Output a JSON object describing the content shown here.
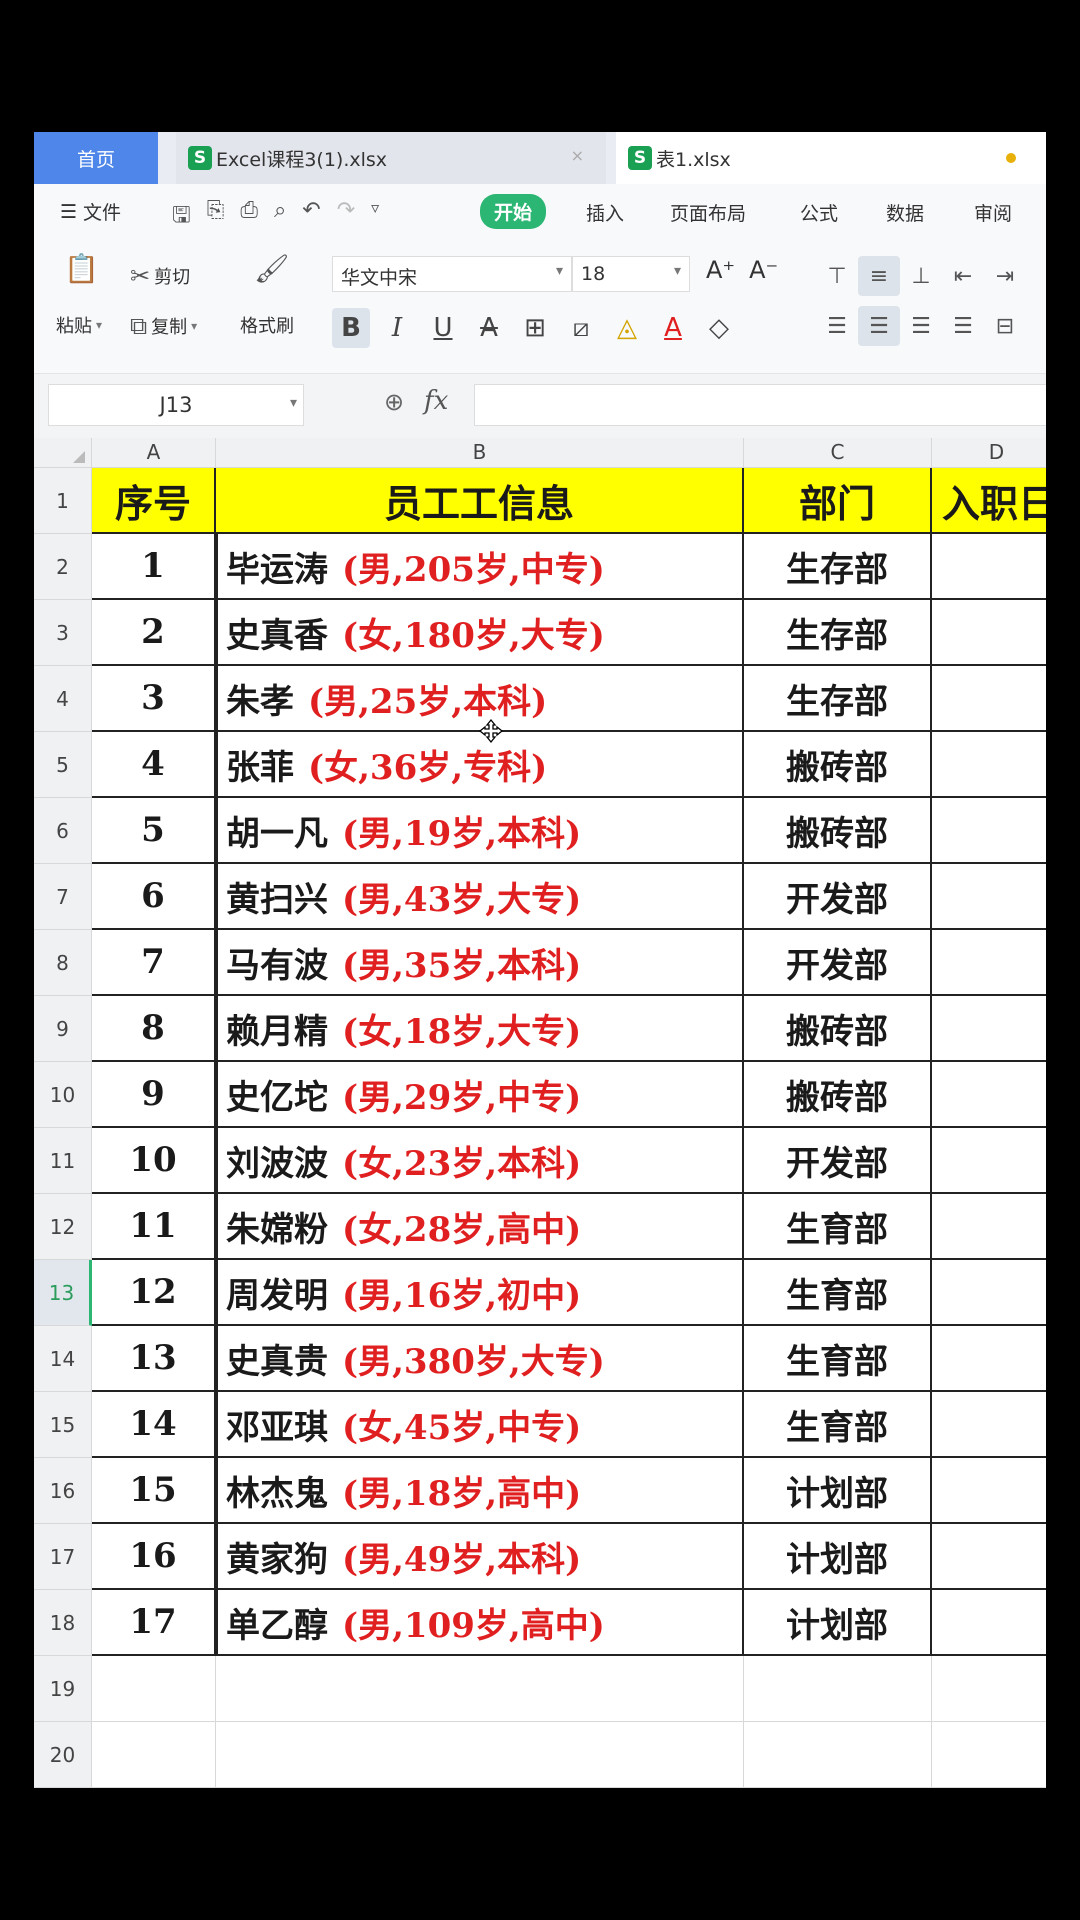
{
  "tabs": {
    "home": "首页",
    "excel": "Excel课程3(1).xlsx",
    "active": "表1.xlsx",
    "close": "×",
    "sheet_letter": "S"
  },
  "menu": {
    "file": "文件",
    "items": [
      "开始",
      "插入",
      "页面布局",
      "公式",
      "数据",
      "审阅"
    ],
    "active_index": 0
  },
  "ribbon": {
    "cut": "剪切",
    "paste": "粘贴",
    "copy": "复制",
    "format_painter": "格式刷",
    "font_name": "华文中宋",
    "font_size": "18"
  },
  "formula_bar": {
    "name_box": "J13",
    "fx": "fx",
    "value": ""
  },
  "grid": {
    "columns": [
      "A",
      "B",
      "C",
      "D"
    ],
    "header_row": {
      "row": "1",
      "seq": "序号",
      "info": "员工工信息",
      "dept": "部门",
      "date": "入职日"
    },
    "rows": [
      {
        "row": "2",
        "seq": "1",
        "name": "毕运涛",
        "detail": "(男,205岁,中专)",
        "dept": "生存部"
      },
      {
        "row": "3",
        "seq": "2",
        "name": "史真香",
        "detail": "(女,180岁,大专)",
        "dept": "生存部"
      },
      {
        "row": "4",
        "seq": "3",
        "name": "朱孝",
        "detail": "(男,25岁,本科)",
        "dept": "生存部"
      },
      {
        "row": "5",
        "seq": "4",
        "name": "张菲",
        "detail": "(女,36岁,专科)",
        "dept": "搬砖部"
      },
      {
        "row": "6",
        "seq": "5",
        "name": "胡一凡",
        "detail": "(男,19岁,本科)",
        "dept": "搬砖部"
      },
      {
        "row": "7",
        "seq": "6",
        "name": "黄扫兴",
        "detail": "(男,43岁,大专)",
        "dept": "开发部"
      },
      {
        "row": "8",
        "seq": "7",
        "name": "马有波",
        "detail": "(男,35岁,本科)",
        "dept": "开发部"
      },
      {
        "row": "9",
        "seq": "8",
        "name": "赖月精",
        "detail": "(女,18岁,大专)",
        "dept": "搬砖部"
      },
      {
        "row": "10",
        "seq": "9",
        "name": "史亿坨",
        "detail": "(男,29岁,中专)",
        "dept": "搬砖部"
      },
      {
        "row": "11",
        "seq": "10",
        "name": "刘波波",
        "detail": "(女,23岁,本科)",
        "dept": "开发部"
      },
      {
        "row": "12",
        "seq": "11",
        "name": "朱嫦粉",
        "detail": "(女,28岁,高中)",
        "dept": "生育部"
      },
      {
        "row": "13",
        "seq": "12",
        "name": "周发明",
        "detail": "(男,16岁,初中)",
        "dept": "生育部"
      },
      {
        "row": "14",
        "seq": "13",
        "name": "史真贵",
        "detail": "(男,380岁,大专)",
        "dept": "生育部"
      },
      {
        "row": "15",
        "seq": "14",
        "name": "邓亚琪",
        "detail": "(女,45岁,中专)",
        "dept": "生育部"
      },
      {
        "row": "16",
        "seq": "15",
        "name": "林杰鬼",
        "detail": "(男,18岁,高中)",
        "dept": "计划部"
      },
      {
        "row": "17",
        "seq": "16",
        "name": "黄家狗",
        "detail": "(男,49岁,本科)",
        "dept": "计划部"
      },
      {
        "row": "18",
        "seq": "17",
        "name": "单乙醇",
        "detail": "(男,109岁,高中)",
        "dept": "计划部"
      }
    ],
    "empty_rows": [
      "19",
      "20"
    ],
    "selected_row": "13"
  },
  "colors": {
    "header_fill": "#ffff00",
    "detail_text": "#e02020",
    "active_tab": "#2bb673",
    "home_tab": "#4f86ea"
  }
}
